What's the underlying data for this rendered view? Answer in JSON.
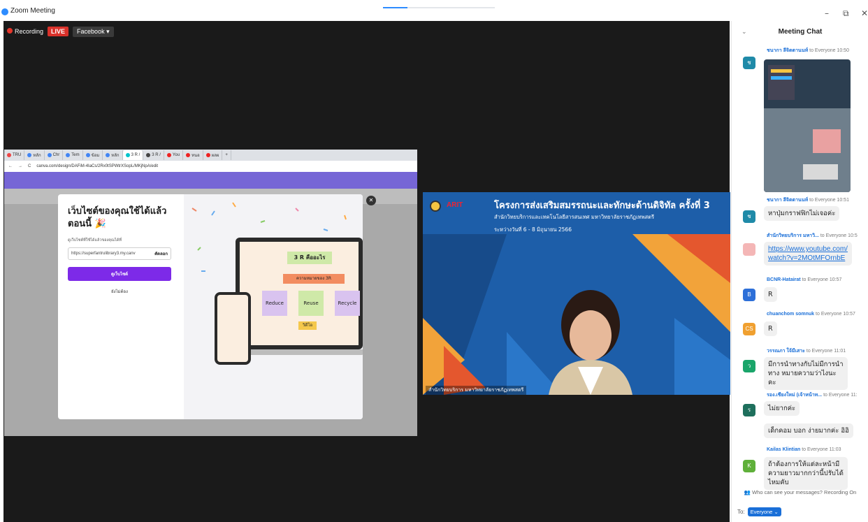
{
  "window": {
    "title": "Zoom Meeting",
    "controls": {
      "minimize": "–",
      "restore": "⧉",
      "close": "✕"
    }
  },
  "meeting": {
    "recording_label": "Recording",
    "live_label": "LIVE",
    "stream_target": "Facebook ▾"
  },
  "browser": {
    "tabs": [
      "TRU",
      "หลัก",
      "Chr",
      "Tem",
      "ข้อม",
      "หลัก",
      "3 R /",
      "3 R /",
      "You",
      "หนอ",
      "ผลผ",
      "+"
    ],
    "url": "canva.com/design/DAFiM-4IaCs/2Rx0tSPWtrXSopL/MKjNpA/edit"
  },
  "modal": {
    "title": "เว็บไซต์ของคุณใช้ได้แล้วตอนนี้ 🎉",
    "link_label": "ดูเว็บไซต์ที่ใช้ได้แล้วของคุณได้ที่",
    "url_value": "https://superfantrulibrary3.my.canv",
    "copy_label": "คัดลอก",
    "view_button": "ดูเว็บไซต์",
    "close_label": "ยังไม่ต้อง",
    "preview": {
      "title": "3 R คืออะไร",
      "subtitle": "ความหมายของ 3R",
      "cards": [
        "Reduce",
        "Reuse",
        "Recycle"
      ],
      "footer_button": "วิดีโอ"
    }
  },
  "video": {
    "slide_title": "โครงการส่งเสริมสมรรถนะและทักษะด้านดิจิทัล ครั้งที่ 3",
    "slide_subtitle": "สำนักวิทยบริการและเทคโนโลยีสารสนเทศ มหาวิทยาลัยราชภัฏเทพสตรี",
    "slide_date": "ระหว่างวันที่ 6 - 8 มิถุนายน 2566",
    "logo_text": "ARIT",
    "participant_name": "สำนักวิทยบริการ มหาวิทยาลัยราชภัฏเทพสตรี"
  },
  "chat": {
    "title": "Meeting Chat",
    "messages": [
      {
        "from": "ชนากา ลีจิตตานนท์",
        "to": "to Everyone",
        "time": "10:50",
        "avatar": "ช",
        "type": "image"
      },
      {
        "from": "ชนากา ลีจิตตานนท์",
        "to": "to Everyone",
        "time": "10:51",
        "avatar": "ช",
        "text": "หาปุ่มกราฟฟิกไม่เจอค่ะ"
      },
      {
        "from": "สำนักวิทยบริการ มหาวิ...",
        "to": "to Everyone",
        "time": "10:5",
        "avatar": "",
        "text": "https://www.youtube.com/watch?v=2MOtMFOrnbE",
        "link": true
      },
      {
        "from": "BCNR-Hatairat",
        "to": "to Everyone",
        "time": "10:57",
        "avatar": "B",
        "text": "R"
      },
      {
        "from": "chuanchom somnuk",
        "to": "to Everyone",
        "time": "10:57",
        "avatar": "CS",
        "text": "R"
      },
      {
        "from": "วรรณภา ใจ้มีเสาะ",
        "to": "to Everyone",
        "time": "11:01",
        "avatar": "ว",
        "text": "มีการนำทางกับไม่มีการนำทาง หมายความว่าไงนะคะ"
      },
      {
        "from": "รอง.เชียงใหม่ (เจ้าหน้าท...",
        "to": "to Everyone",
        "time": "11:",
        "avatar": "ร",
        "text": "ไม่ยากค่ะ"
      },
      {
        "from": "",
        "to": "",
        "time": "",
        "avatar": "",
        "text": "เด็กคอม บอก ง่ายมากค่ะ อิอิ"
      },
      {
        "from": "Kailas Klintian",
        "to": "to Everyone",
        "time": "11:03",
        "avatar": "K",
        "text": "ถ้าต้องการให้แต่ละหน้ามีความยาวมากกว่านี้ปรับได้ไหมคับ"
      }
    ],
    "visibility_note": "Who can see your messages? Recording On",
    "to_label": "To:",
    "to_value": "Everyone ⌄"
  },
  "colors": {
    "zoom_blue": "#2d8cff",
    "live_red": "#d9312a",
    "canva_purple": "#7d2ae8",
    "chat_link": "#1a6fd8"
  }
}
